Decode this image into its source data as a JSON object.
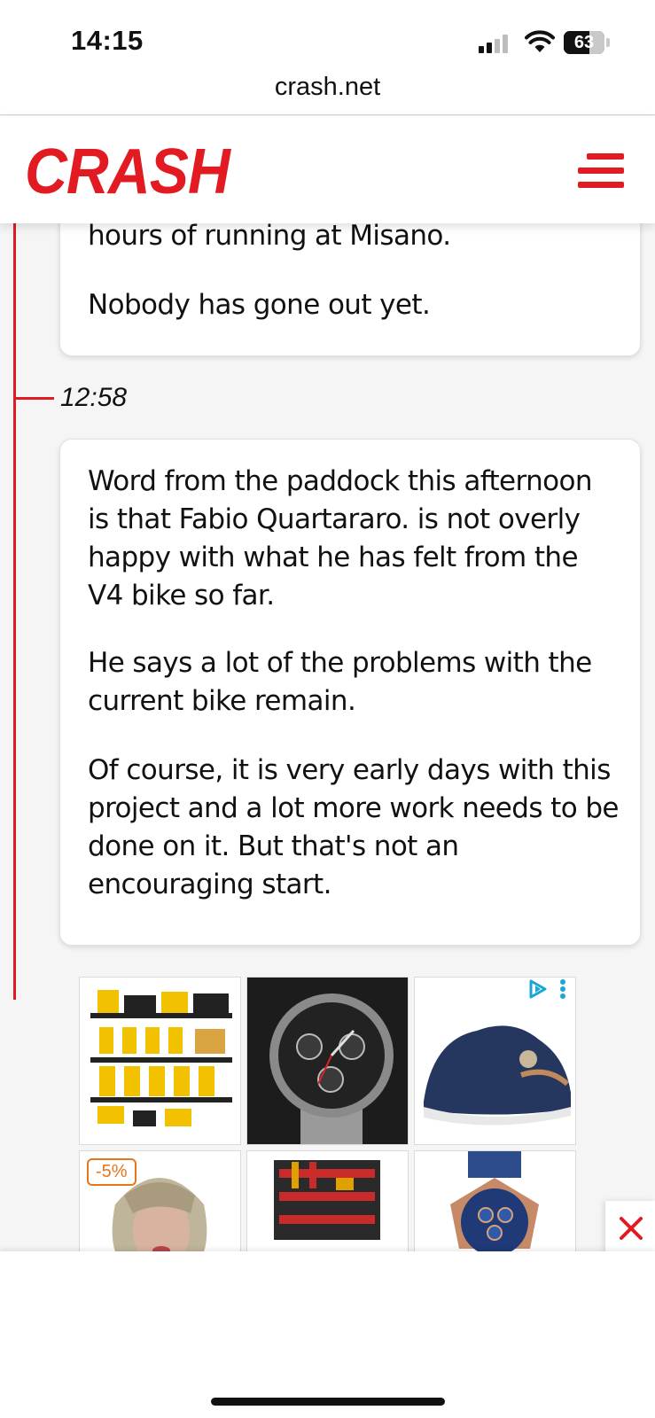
{
  "status_bar": {
    "time": "14:15",
    "battery": "63",
    "battery_fraction": 0.63
  },
  "url_bar": {
    "domain": "crash.net"
  },
  "header": {
    "logo": "CRASH",
    "brand_color": "#e21b23"
  },
  "feed": {
    "entries": [
      {
        "paragraphs": [
          "hours of running at Misano.",
          "Nobody has gone out yet."
        ]
      },
      {
        "time": "12:58",
        "paragraphs": [
          "Word from the paddock this afternoon is that Fabio Quartararo. is not overly happy with what he has felt from the V4 bike so far.",
          "He says a lot of the problems with the current bike remain.",
          "Of course, it is very early days with this project and a lot more work needs to be done on it. But that's not an encouraging start."
        ]
      }
    ]
  },
  "ad": {
    "tiles": [
      {
        "name": "tool-rack"
      },
      {
        "name": "chronograph-watch"
      },
      {
        "name": "sneaker"
      },
      {
        "name": "wig",
        "badge": "-5%"
      },
      {
        "name": "tool-wall"
      },
      {
        "name": "blue-watch"
      }
    ]
  }
}
